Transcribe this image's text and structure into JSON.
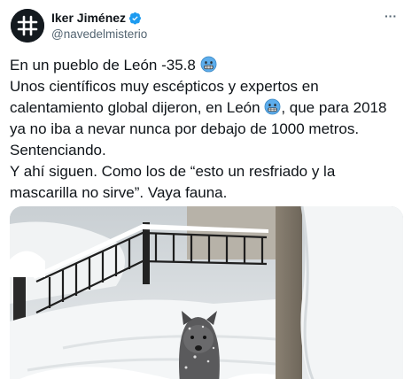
{
  "author": {
    "display_name": "Iker Jiménez",
    "handle": "@navedelmisterio",
    "verified": true,
    "avatar_icon": "hashtag-grid-icon"
  },
  "tweet": {
    "line1": "En un pueblo de León -35.8",
    "line2": "Unos científicos muy escépticos y expertos en",
    "line3a": "calentamiento global dijeron, en León",
    "line3b": ", que para 2018",
    "line4": "ya no iba a nevar nunca por debajo de 1000 metros.",
    "line5": "Sentenciando.",
    "line6": "Y ahí siguen. Como los de “esto un resfriado y la",
    "line7": "mascarilla no sirve”. Vaya fauna.",
    "emoji_icon": "freezing-face-emoji"
  },
  "media": {
    "icon": "snowy-stairs-dog-photo"
  },
  "colors": {
    "text": "#0f1419",
    "secondary": "#536471",
    "verified": "#1d9bf0"
  }
}
